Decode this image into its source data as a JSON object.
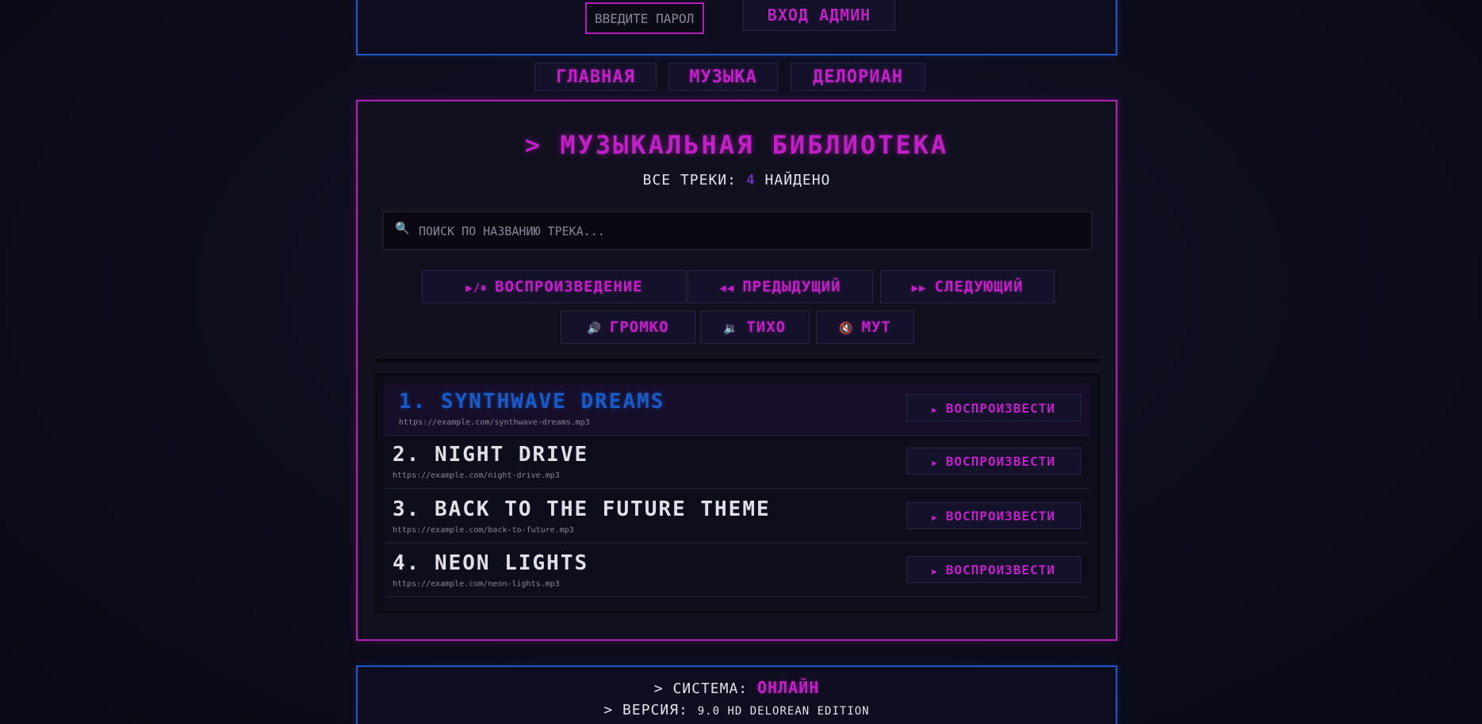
{
  "admin": {
    "password_placeholder": "ВВЕДИТЕ ПАРОЛЬ А",
    "login_label": "ВХОД АДМИН"
  },
  "nav": {
    "items": [
      {
        "label": "ГЛАВНАЯ"
      },
      {
        "label": "МУЗЫКА"
      },
      {
        "label": "ДЕЛОРИАН"
      }
    ]
  },
  "library": {
    "title": "> МУЗЫКАЛЬНАЯ БИБЛИОТЕКА",
    "count_prefix": "ВСЕ ТРЕКИ:",
    "count": "4",
    "count_suffix": "НАЙДЕНО",
    "search_icon": "🔍",
    "search_placeholder": "ПОИСК ПО НАЗВАНИЮ ТРЕКА...",
    "controls": [
      {
        "icon": "▶/⏸",
        "label": "ВОСПРОИЗВЕДЕНИЕ"
      },
      {
        "icon": "◀◀",
        "label": "ПРЕДЫДУЩИЙ"
      },
      {
        "icon": "▶▶",
        "label": "СЛЕДУЮЩИЙ"
      },
      {
        "icon": "🔊",
        "label": "ГРОМКО"
      },
      {
        "icon": "🔉",
        "label": "ТИХО"
      },
      {
        "icon": "🔇",
        "label": "МУТ"
      }
    ],
    "play_icon": "▶",
    "play_label": "ВОСПРОИЗВЕСТИ",
    "tracks": [
      {
        "title": "1. SYNTHWAVE DREAMS",
        "url": "https://example.com/synthwave-dreams.mp3"
      },
      {
        "title": "2. NIGHT DRIVE",
        "url": "https://example.com/night-drive.mp3"
      },
      {
        "title": "3. BACK TO THE FUTURE THEME",
        "url": "https://example.com/back-to-future.mp3"
      },
      {
        "title": "4. NEON LIGHTS",
        "url": "https://example.com/neon-lights.mp3"
      }
    ]
  },
  "footer": {
    "system_label": "> СИСТЕМА:",
    "system_status": "ОНЛАЙН",
    "version_label": "> ВЕРСИЯ:",
    "version_value": "9.0 HD DELOREAN EDITION"
  },
  "colors": {
    "accent_magenta": "#c020c5",
    "accent_blue": "#1a5bc8",
    "background": "#0d0c1c"
  }
}
